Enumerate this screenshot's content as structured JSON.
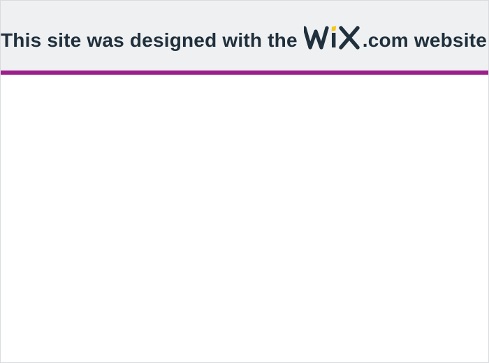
{
  "banner": {
    "text_before": "This site was designed with the",
    "logo_text": "WIX",
    "text_after": ".com website builder. Create your website today.",
    "logo_name": "wix-logo-icon"
  },
  "colors": {
    "banner_bg": "#eef0f2",
    "banner_text": "#20303c",
    "accent_bar": "#9b1f8b",
    "logo_dot": "#f5c518",
    "page_bg": "#ffffff"
  }
}
